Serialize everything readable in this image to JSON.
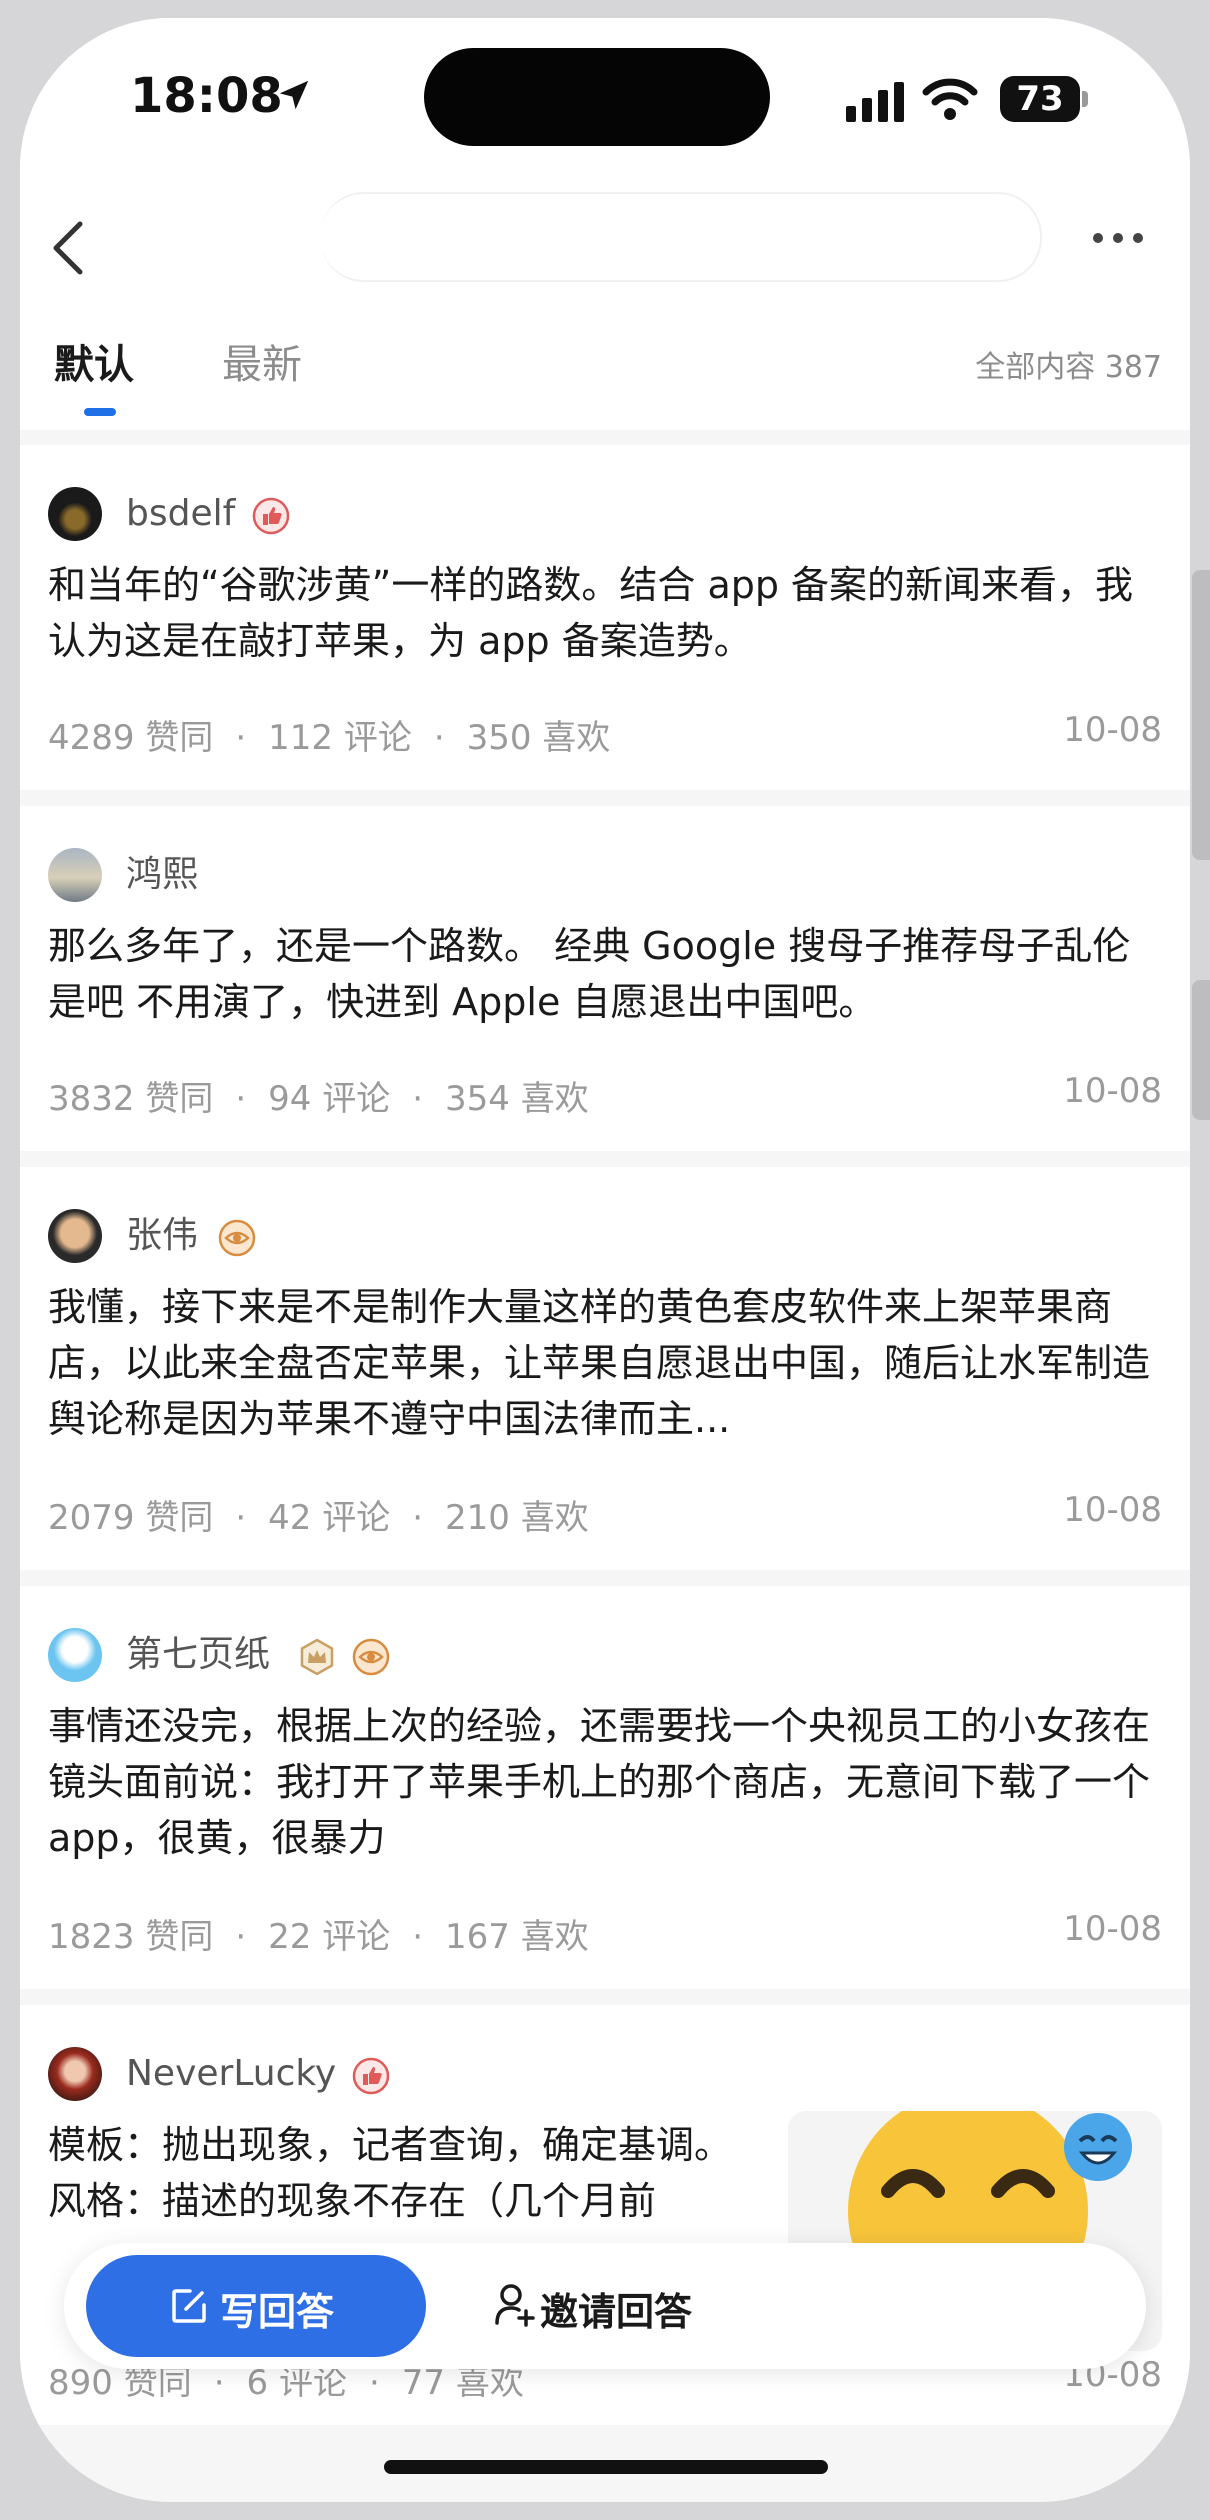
{
  "status_bar": {
    "time": "18:08",
    "battery": "73",
    "icons": [
      "location-arrow-icon",
      "signal-icon",
      "wifi-icon",
      "battery-icon"
    ]
  },
  "nav": {
    "back_icon": "back-chevron-icon",
    "more_icon": "more-dots-icon"
  },
  "tabs": {
    "default_label": "默认",
    "latest_label": "最新",
    "total_label": "全部内容 387"
  },
  "answers": [
    {
      "author": "bsdelf",
      "badges": [
        "thumbs-up-badge"
      ],
      "content": "和当年的“谷歌涉黄”一样的路数。结合 app 备案的新闻来看，我认为这是在敲打苹果，为 app 备案造势。",
      "likes": "4289 赞同",
      "comments": "112 评论",
      "favorites": "350 喜欢",
      "date": "10-08"
    },
    {
      "author": "鸿熙",
      "badges": [],
      "content": "那么多年了，还是一个路数。 经典 Google 搜母子推荐母子乱伦是吧 不用演了，快进到 Apple 自愿退出中国吧。",
      "likes": "3832 赞同",
      "comments": "94 评论",
      "favorites": "354 喜欢",
      "date": "10-08"
    },
    {
      "author": "张伟",
      "badges": [
        "eye-badge"
      ],
      "content": "我懂，接下来是不是制作大量这样的黄色套皮软件来上架苹果商店，以此来全盘否定苹果，让苹果自愿退出中国，随后让水军制造舆论称是因为苹果不遵守中国法律而主...",
      "likes": "2079 赞同",
      "comments": "42 评论",
      "favorites": "210 喜欢",
      "date": "10-08"
    },
    {
      "author": "第七页纸",
      "badges": [
        "crown-badge",
        "eye-badge"
      ],
      "content": "事情还没完，根据上次的经验，还需要找一个央视员工的小女孩在镜头面前说：我打开了苹果手机上的那个商店，无意间下载了一个app，很黄，很暴力",
      "likes": "1823 赞同",
      "comments": "22 评论",
      "favorites": "167 喜欢",
      "date": "10-08"
    },
    {
      "author": "NeverLucky",
      "badges": [
        "thumbs-up-badge"
      ],
      "content": "模板：抛出现象，记者查询，确定基调。 风格：描述的现象不存在（几个月前",
      "likes": "890 赞同",
      "comments": "6 评论",
      "favorites": "77 喜欢",
      "date": "10-08",
      "thumbnail": "laughing-emoji-image"
    }
  ],
  "bottom_bar": {
    "write_label": "写回答",
    "invite_label": "邀请回答"
  },
  "colors": {
    "accent": "#2f6fe6",
    "text": "#1a1a1a",
    "secondary": "#9a9a9a"
  }
}
